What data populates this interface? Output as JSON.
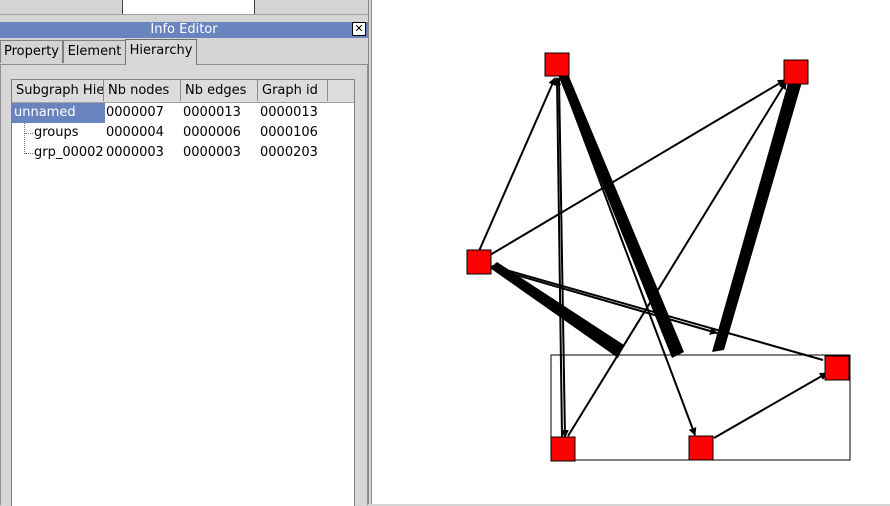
{
  "window": {
    "title": "Info Editor",
    "close_glyph": "✕"
  },
  "tabs": [
    {
      "label": "Property",
      "active": false
    },
    {
      "label": "Element",
      "active": false
    },
    {
      "label": "Hierarchy",
      "active": true
    }
  ],
  "hierarchy": {
    "columns": [
      "Subgraph Hie",
      "Nb nodes",
      "Nb edges",
      "Graph id"
    ],
    "rows": [
      {
        "name": "unnamed",
        "nb_nodes": "0000007",
        "nb_edges": "0000013",
        "graph_id": "0000013",
        "selected": true
      },
      {
        "name": "groups",
        "nb_nodes": "0000004",
        "nb_edges": "0000006",
        "graph_id": "0000106",
        "selected": false
      },
      {
        "name": "grp_00002",
        "nb_nodes": "0000003",
        "nb_edges": "0000003",
        "graph_id": "0000203",
        "selected": false
      }
    ]
  },
  "graph": {
    "node_color": "#ff0000",
    "edge_color": "#000000"
  }
}
